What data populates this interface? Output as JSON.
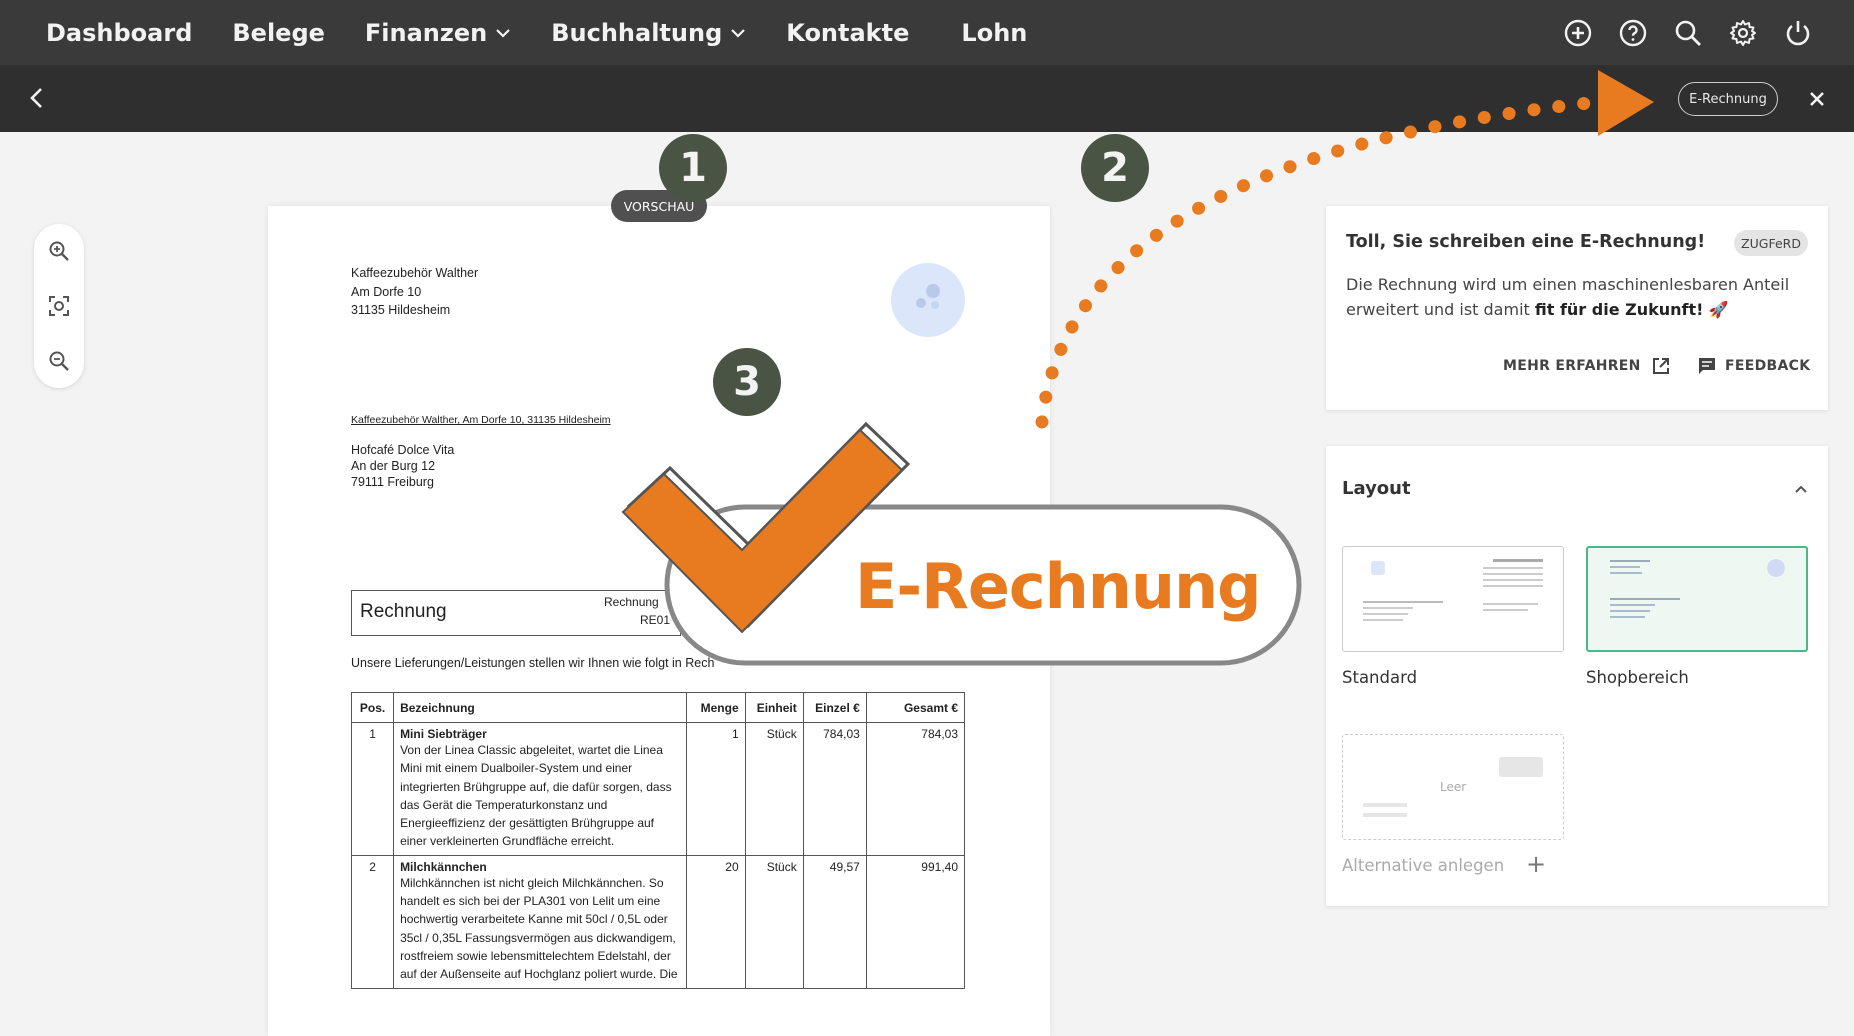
{
  "topnav": {
    "items": [
      "Dashboard",
      "Belege",
      "Finanzen",
      "Buchhaltung",
      "Kontakte",
      "Lohn"
    ],
    "icons": [
      "plus-circle-icon",
      "help-icon",
      "search-icon",
      "gear-icon",
      "power-icon"
    ]
  },
  "subbar": {
    "pill_label": "E-Rechnung"
  },
  "document": {
    "badge": "VORSCHAU",
    "sender": [
      "Kaffeezubehör Walther",
      "Am Dorfe 10",
      "31135 Hildesheim"
    ],
    "sender_line": "Kaffeezubehör Walther, Am Dorfe 10, 31135 Hildesheim",
    "recipient": [
      "Hofcafé Dolce Vita",
      "An der Burg 12",
      "79111 Freiburg"
    ],
    "invoice_title": "Rechnung",
    "invoice_number_label": "Rechnung",
    "invoice_number": "RE01",
    "intro": "Unsere Lieferungen/Leistungen stellen wir Ihnen wie folgt in Rech",
    "table": {
      "headers": [
        "Pos.",
        "Bezeichnung",
        "Menge",
        "Einheit",
        "Einzel €",
        "Gesamt €"
      ],
      "rows": [
        {
          "pos": "1",
          "name": "Mini Siebträger",
          "desc": "Von der Linea Classic abgeleitet, wartet die Linea Mini mit einem Dualboiler-System und einer integrierten Brühgruppe auf, die dafür sorgen, dass das Gerät die Temperaturkonstanz und Energieeffizienz der gesättigten Brühgruppe auf einer verkleinerten Grundfläche erreicht.",
          "menge": "1",
          "einheit": "Stück",
          "einzel": "784,03",
          "gesamt": "784,03"
        },
        {
          "pos": "2",
          "name": "Milchkännchen",
          "desc": "Milchkännchen ist nicht gleich Milchkännchen. So handelt es sich bei der PLA301 von Lelit um eine hochwertig verarbeitete Kanne mit 50cl / 0,5L oder 35cl / 0,35L Fassungsvermögen aus dickwandigem, rostfreiem sowie lebensmittelechtem Edelstahl, der auf der Außenseite auf Hochglanz poliert wurde. Die",
          "menge": "20",
          "einheit": "Stück",
          "einzel": "49,57",
          "gesamt": "991,40"
        }
      ]
    }
  },
  "info_card": {
    "title": "Toll, Sie schreiben eine E-Rechnung!",
    "badge": "ZUGFeRD",
    "text_plain": "Die Rechnung wird um einen maschinenlesbaren Anteil erweitert und ist damit ",
    "text_bold": "fit für die Zukunft!",
    "text_emoji": " 🚀",
    "more_label": "MEHR ERFAHREN",
    "feedback_label": "FEEDBACK"
  },
  "layout_card": {
    "title": "Layout",
    "options": [
      {
        "label": "Standard",
        "selected": false
      },
      {
        "label": "Shopbereich",
        "selected": true
      }
    ],
    "empty_label": "Leer",
    "alt_label": "Alternative anlegen",
    "alt_plus": "+"
  },
  "markers": [
    "1",
    "2",
    "3"
  ],
  "overlay_badge": "E-Rechnung",
  "colors": {
    "accent_orange": "#e87b1f",
    "marker_bg": "#4a5444",
    "selected_green": "#4cb88a",
    "nav_bg": "#3a3a3a"
  }
}
